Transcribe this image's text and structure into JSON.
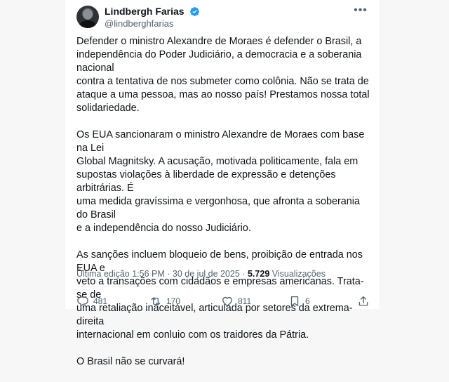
{
  "author": {
    "display_name": "Lindbergh Farias",
    "handle": "@lindberghfarias"
  },
  "post": {
    "paragraphs": [
      "Defender o ministro Alexandre de Moraes é defender o Brasil, a\nindependência do Poder Judiciário, a democracia e a soberania nacional\ncontra a tentativa de nos submeter como colônia. Não se trata de\nataque a uma pessoa, mas ao nosso país! Prestamos nossa total\nsolidariedade.",
      "Os EUA sancionaram o ministro Alexandre de Moraes com base na Lei\nGlobal Magnitsky. A acusação, motivada politicamente, fala em\nsupostas violações à liberdade de expressão e detenções arbitrárias. É\numa medida gravíssima e vergonhosa, que afronta a soberania do Brasil\ne a independência do nosso Judiciário.",
      "As sanções incluem bloqueio de bens, proibição de entrada nos EUA e\nveto a transações com cidadãos e empresas americanas. Trata-se de\numa retaliação inaceitável, articulada por setores da extrema-direita\ninternacional em conluio com os traidores da Pátria.",
      "O Brasil não se curvará!"
    ],
    "edit_label": "Última edição",
    "time": "1:56 PM",
    "separator": "·",
    "date": "30 de jul de 2025",
    "views_count": "5.729",
    "views_label": "Visualizações"
  },
  "actions": {
    "replies": "481",
    "reposts": "170",
    "likes": "811",
    "bookmarks": "6"
  },
  "icons": {
    "verified": "verified-badge-icon",
    "more": "more-options-icon",
    "reply": "reply-icon",
    "repost": "repost-icon",
    "like": "heart-icon",
    "bookmark": "bookmark-icon",
    "share": "share-icon"
  },
  "colors": {
    "verified": "#1d9bf0",
    "text": "#0f1419",
    "secondary": "#536471"
  }
}
